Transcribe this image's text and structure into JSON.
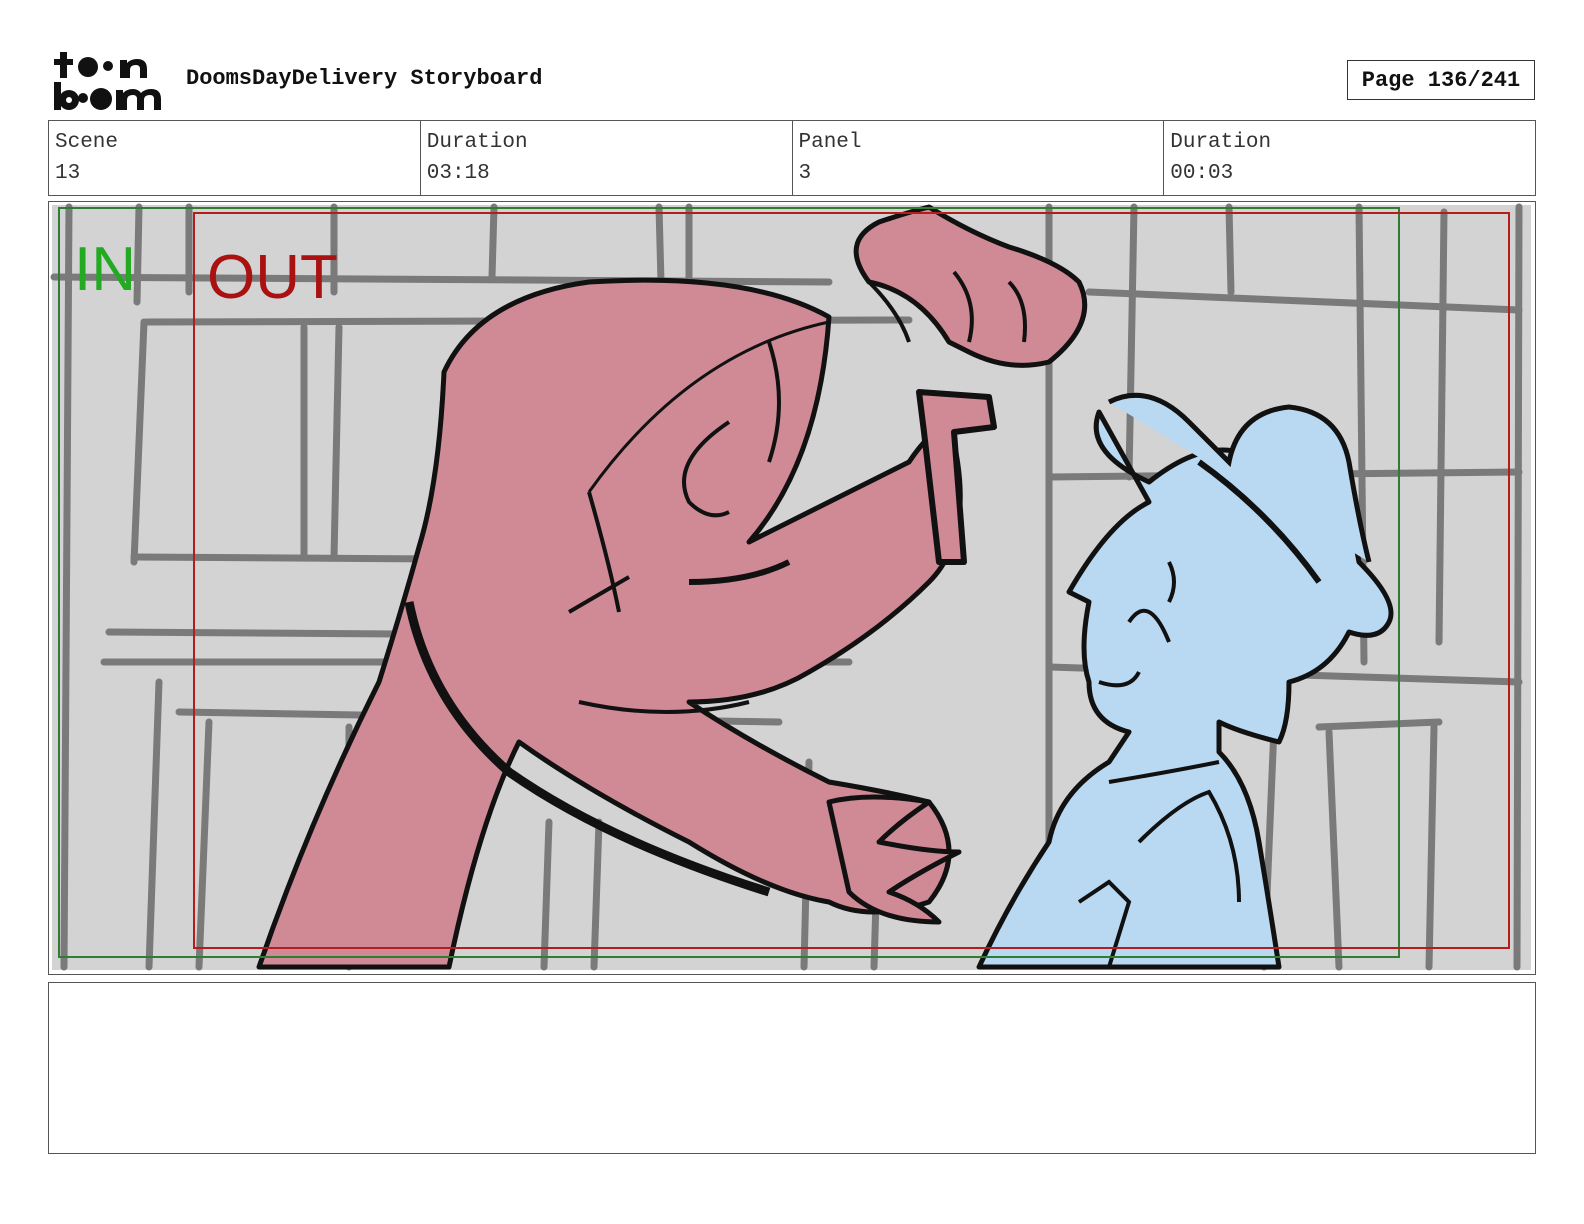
{
  "header": {
    "logo_text_line1": "toon",
    "logo_text_line2": "boom",
    "title": "DoomsDayDelivery Storyboard",
    "page_label": "Page 136/241"
  },
  "info": {
    "scene_label": "Scene",
    "scene_value": "13",
    "scene_duration_label": "Duration",
    "scene_duration_value": "03:18",
    "panel_label": "Panel",
    "panel_value": "3",
    "panel_duration_label": "Duration",
    "panel_duration_value": "00:03"
  },
  "panel": {
    "in_label": "IN",
    "out_label": "OUT",
    "colors": {
      "in_frame": "#2e7d32",
      "in_text": "#22aa22",
      "out_frame": "#b71c1c",
      "out_text": "#aa1111",
      "background": "#d3d3d3",
      "hooded_figure": "#cf8a95",
      "delivery_man": "#b9d8f2",
      "lines": "#111111",
      "background_lines": "#7a7a7a"
    }
  },
  "notes": {
    "text": ""
  }
}
